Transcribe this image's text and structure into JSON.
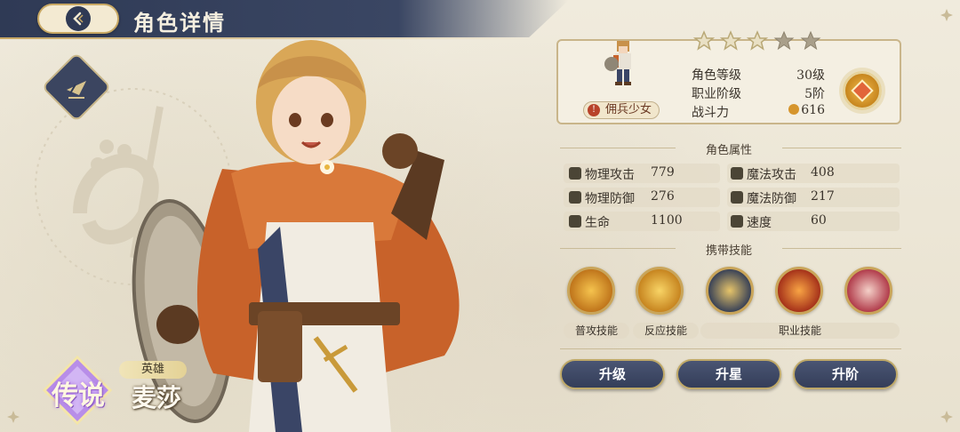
{
  "header": {
    "title": "角色详情",
    "back_icon": "back-arrow-icon"
  },
  "hero": {
    "rarity": "传说",
    "role": "英雄",
    "name": "麦莎",
    "class_icon": "lancer-class-icon"
  },
  "info": {
    "stars_filled": 3,
    "stars_total": 5,
    "job": "佣兵少女",
    "level_label": "角色等级",
    "level_value": "30级",
    "rank_label": "职业阶级",
    "rank_value": "5阶",
    "power_label": "战斗力",
    "power_value": "616"
  },
  "attributes": {
    "title": "角色属性",
    "items": [
      {
        "label": "物理攻击",
        "value": "779",
        "icon": "sword-icon"
      },
      {
        "label": "魔法攻击",
        "value": "408",
        "icon": "staff-icon"
      },
      {
        "label": "物理防御",
        "value": "276",
        "icon": "shield-icon"
      },
      {
        "label": "魔法防御",
        "value": "217",
        "icon": "hat-icon"
      },
      {
        "label": "生命",
        "value": "1100",
        "icon": "heart-icon"
      },
      {
        "label": "速度",
        "value": "60",
        "icon": "boot-icon"
      }
    ]
  },
  "skills": {
    "title": "携带技能",
    "labels": {
      "normal": "普攻技能",
      "reaction": "反应技能",
      "job": "职业技能"
    },
    "icons": [
      "sword-slash-skill-icon",
      "arrow-dash-skill-icon",
      "holy-shield-skill-icon",
      "fire-burst-skill-icon",
      "blade-storm-skill-icon"
    ]
  },
  "actions": {
    "upgrade": "升级",
    "star_up": "升星",
    "rank_up": "升阶"
  },
  "colors": {
    "header_bg": "#2f3a55",
    "gold": "#c9a964",
    "panel_bg": "#ece6d6"
  }
}
